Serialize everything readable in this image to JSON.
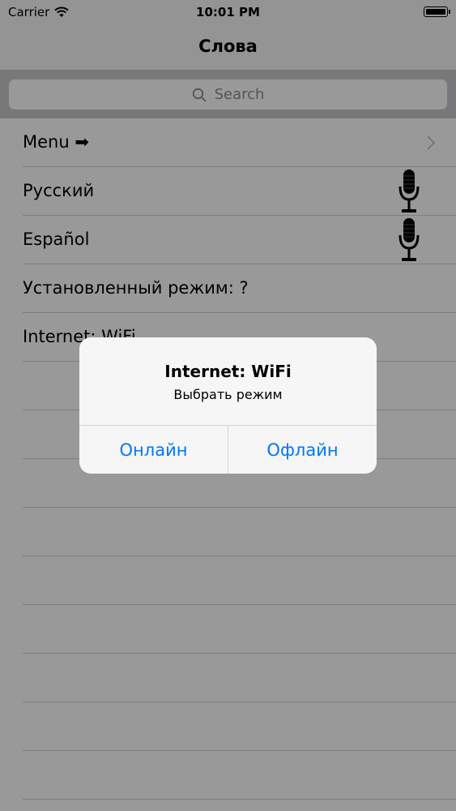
{
  "status_bar": {
    "carrier": "Carrier",
    "time": "10:01 PM",
    "wifi_icon": "wifi-icon",
    "battery_icon": "battery-icon"
  },
  "nav": {
    "title": "Слова"
  },
  "search": {
    "placeholder": "Search",
    "icon": "search-icon"
  },
  "rows": [
    {
      "label": "Menu ➡",
      "accessory": "chevron-right-icon"
    },
    {
      "label": "Русский",
      "accessory": "microphone-icon"
    },
    {
      "label": "Español",
      "accessory": "microphone-icon"
    },
    {
      "label": "Установленный режим: ?"
    },
    {
      "label": "Internet: WiFi"
    }
  ],
  "alert": {
    "title": "Internet: WiFi",
    "message": "Выбрать режим",
    "buttons": [
      "Онлайн",
      "Офлайн"
    ]
  },
  "colors": {
    "accent": "#0076ff",
    "overlay": "rgba(0,0,0,0.40)",
    "search_bar_bg": "#c9c9ce"
  }
}
